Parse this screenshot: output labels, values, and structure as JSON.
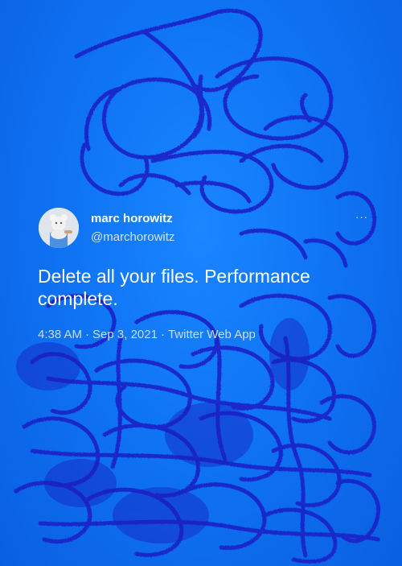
{
  "colors": {
    "background": "#1077f3",
    "scribble": "#1a22c8",
    "text": "#ffffff",
    "muted": "#c9dcfa"
  },
  "tweet": {
    "author_name": "marc horowitz",
    "author_handle": "@marchorowitz",
    "more_icon": "···",
    "text": "Delete all your files. Performance complete.",
    "time": "4:38 AM",
    "date": "Sep 3, 2021",
    "source": "Twitter Web App",
    "separator": "·"
  }
}
